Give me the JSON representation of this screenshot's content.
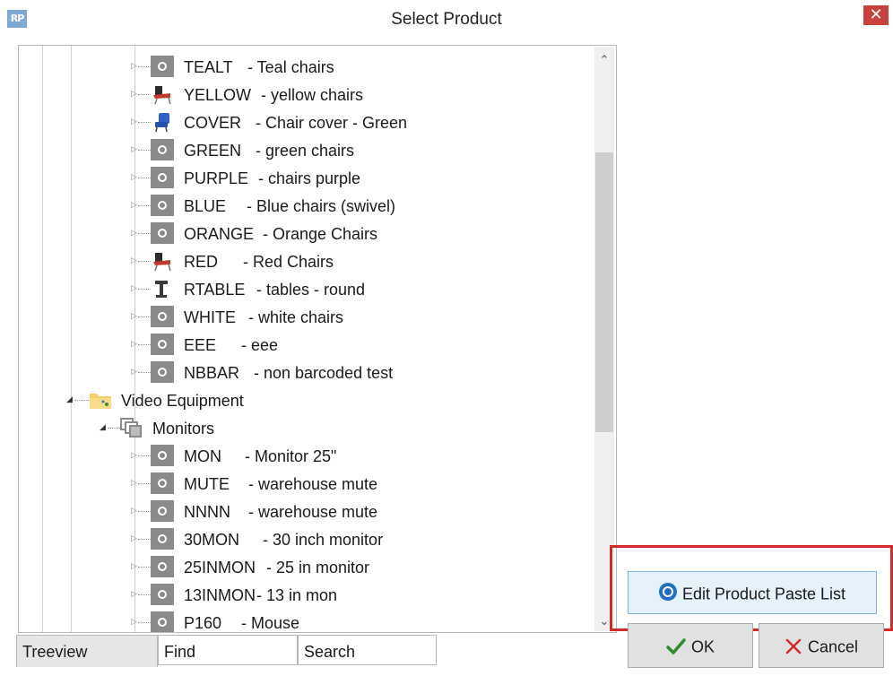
{
  "window": {
    "app_icon_text": "RP",
    "title": "Select Product",
    "close_glyph": "✕"
  },
  "tree": {
    "items": [
      {
        "code": "TEALT",
        "desc": "- Teal chairs",
        "icon": "gray-product-icon"
      },
      {
        "code": "YELLOW",
        "desc": "- yellow chairs",
        "icon": "chair-icon"
      },
      {
        "code": "COVER",
        "desc": "- Chair cover - Green",
        "icon": "blue-chair-icon"
      },
      {
        "code": "GREEN",
        "desc": "- green chairs",
        "icon": "gray-product-icon"
      },
      {
        "code": "PURPLE",
        "desc": "- chairs purple",
        "icon": "gray-product-icon"
      },
      {
        "code": "BLUE",
        "desc": "- Blue chairs (swivel)",
        "icon": "gray-product-icon"
      },
      {
        "code": "ORANGE",
        "desc": "- Orange Chairs",
        "icon": "gray-product-icon"
      },
      {
        "code": "RED",
        "desc": "- Red Chairs",
        "icon": "chair-icon"
      },
      {
        "code": "RTABLE",
        "desc": "- tables - round",
        "icon": "table-icon"
      },
      {
        "code": "WHITE",
        "desc": "- white chairs",
        "icon": "gray-product-icon"
      },
      {
        "code": "EEE",
        "desc": "- eee",
        "icon": "gray-product-icon"
      },
      {
        "code": "NBBAR",
        "desc": "- non barcoded test",
        "icon": "gray-product-icon"
      }
    ],
    "category": {
      "label": "Video Equipment",
      "icon": "folder-icon"
    },
    "subcategory": {
      "label": "Monitors",
      "icon": "group-icon"
    },
    "sub_items": [
      {
        "code": "MON",
        "desc": "- Monitor 25\"",
        "icon": "gray-product-icon"
      },
      {
        "code": "MUTE",
        "desc": "- warehouse mute",
        "icon": "gray-product-icon"
      },
      {
        "code": "NNNN",
        "desc": "- warehouse mute",
        "icon": "gray-product-icon"
      },
      {
        "code": "30MON",
        "desc": "- 30 inch monitor",
        "icon": "gray-product-icon"
      },
      {
        "code": "25INMON",
        "desc": "- 25 in monitor",
        "icon": "gray-product-icon"
      },
      {
        "code": "13INMON",
        "desc": "- 13 in mon",
        "icon": "gray-product-icon"
      },
      {
        "code": "P160",
        "desc": "- Mouse",
        "icon": "gray-product-icon"
      }
    ]
  },
  "tabs": [
    {
      "label": "Treeview",
      "active": true
    },
    {
      "label": "Find",
      "active": false
    },
    {
      "label": "Search",
      "active": false
    }
  ],
  "buttons": {
    "edit_label": "Edit Product Paste List",
    "ok_label": "OK",
    "cancel_label": "Cancel"
  },
  "colors": {
    "highlight_border": "#d02a2a",
    "ok_check": "#2e8b2e",
    "cancel_x": "#d02a2a",
    "edit_icon": "#1f6fc4"
  }
}
